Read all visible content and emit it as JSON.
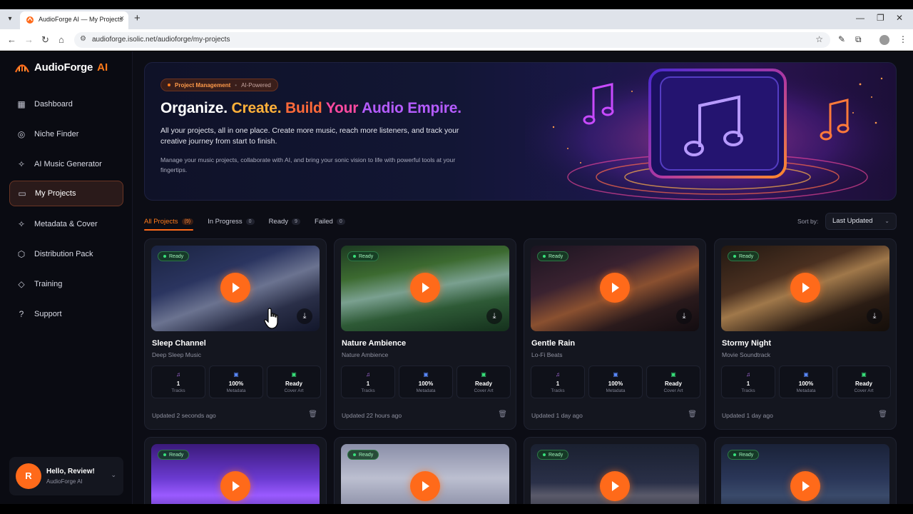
{
  "browser": {
    "tab_title": "AudioForge AI — My Projects",
    "tab_close": "×",
    "new_tab": "+",
    "url": "audioforge.isolic.net/audioforge/my-projects",
    "icons": [
      "back-icon",
      "forward-icon",
      "reload-icon",
      "home-icon",
      "site-info-icon",
      "star-icon",
      "pen-icon",
      "extensions-icon",
      "profile-icon",
      "menu-icon"
    ]
  },
  "app": {
    "logo": {
      "text": "AudioForge",
      "accent": "AI"
    },
    "nav": [
      {
        "label": "Dashboard",
        "icon": "grid-icon"
      },
      {
        "label": "Niche Finder",
        "icon": "compass-icon"
      },
      {
        "label": "AI Music Generator",
        "icon": "wand-icon"
      },
      {
        "label": "My Projects",
        "icon": "folder-icon",
        "active": true
      },
      {
        "label": "Metadata & Cover",
        "icon": "wand-icon"
      },
      {
        "label": "Distribution Pack",
        "icon": "package-icon"
      },
      {
        "label": "Training",
        "icon": "graduation-icon"
      },
      {
        "label": "Support",
        "icon": "help-icon"
      }
    ],
    "user": {
      "initial": "R",
      "greeting": "Hello, Review!",
      "subtitle": "AudioForge AI"
    }
  },
  "hero": {
    "pill_a": "Project Management",
    "pill_sep": "•",
    "pill_b": "AI-Powered",
    "title_parts": [
      "Organize.",
      "Create.",
      "Build",
      "Your",
      "Audio Empire."
    ],
    "description": "All your projects, all in one place. Create more music, reach more listeners, and track your creative journey from start to finish.",
    "description2": "Manage your music projects, collaborate with AI, and bring your sonic vision to life with powerful tools at your fingertips."
  },
  "filters": [
    {
      "label": "All Projects",
      "count": "(9)",
      "active": true
    },
    {
      "label": "In Progress",
      "count": "0"
    },
    {
      "label": "Ready",
      "count": "9"
    },
    {
      "label": "Failed",
      "count": "0"
    }
  ],
  "sort": {
    "label": "Sort by:",
    "value": "Last Updated"
  },
  "cards": [
    {
      "badge": "Ready",
      "title": "Sleep Channel",
      "subtitle": "Deep Sleep Music",
      "tracks": "1",
      "tracks_label": "Tracks",
      "metadata": "100%",
      "metadata_label": "Metadata",
      "cover": "Ready",
      "cover_label": "Cover Art",
      "updated": "Updated 2 seconds ago",
      "theme": "night"
    },
    {
      "badge": "Ready",
      "title": "Nature Ambience",
      "subtitle": "Nature Ambience",
      "tracks": "1",
      "tracks_label": "Tracks",
      "metadata": "100%",
      "metadata_label": "Metadata",
      "cover": "Ready",
      "cover_label": "Cover Art",
      "updated": "Updated 22 hours ago",
      "theme": "forest"
    },
    {
      "badge": "Ready",
      "title": "Gentle Rain",
      "subtitle": "Lo-Fi Beats",
      "tracks": "1",
      "tracks_label": "Tracks",
      "metadata": "100%",
      "metadata_label": "Metadata",
      "cover": "Ready",
      "cover_label": "Cover Art",
      "updated": "Updated 1 day ago",
      "theme": "lofi"
    },
    {
      "badge": "Ready",
      "title": "Stormy Night",
      "subtitle": "Movie Soundtrack",
      "tracks": "1",
      "tracks_label": "Tracks",
      "metadata": "100%",
      "metadata_label": "Metadata",
      "cover": "Ready",
      "cover_label": "Cover Art",
      "updated": "Updated 1 day ago",
      "theme": "piano"
    },
    {
      "badge": "Ready",
      "theme": "lotus"
    },
    {
      "badge": "Ready",
      "theme": "mist"
    },
    {
      "badge": "Ready",
      "theme": "lake"
    },
    {
      "badge": "Ready",
      "theme": "moonlake"
    }
  ],
  "colors": {
    "accent": "#ff6a1a",
    "ready_green": "#38e07a",
    "bg": "#0c0d15"
  }
}
